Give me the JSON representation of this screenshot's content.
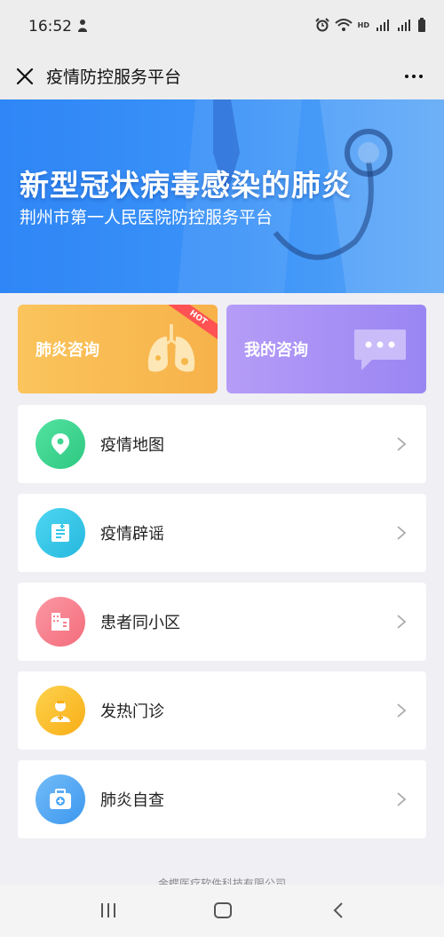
{
  "status_bar": {
    "time": "16:52",
    "left_icon": "notification-icon",
    "right_icons": [
      "alarm-icon",
      "wifi-icon",
      "hd-icon",
      "signal-4g-icon",
      "signal-4g-icon",
      "battery-icon"
    ],
    "hd_label": "HD",
    "network_label": "4G"
  },
  "title_bar": {
    "title": "疫情防控服务平台",
    "close_icon": "close-icon",
    "more_icon": "more-icon"
  },
  "banner": {
    "title": "新型冠状病毒感染的肺炎",
    "subtitle": "荆州市第一人民医院防控服务平台",
    "colors": {
      "start": "#2f86f6",
      "end": "#5aa6f6"
    }
  },
  "cards": [
    {
      "label": "肺炎咨询",
      "badge": "HOT",
      "icon": "lungs-icon",
      "color": "#f7b24a"
    },
    {
      "label": "我的咨询",
      "icon": "chat-bubble-icon",
      "color": "#9a86f3"
    }
  ],
  "menu": [
    {
      "label": "疫情地图",
      "icon": "location-pin-icon",
      "color": "#3ed68f"
    },
    {
      "label": "疫情辟谣",
      "icon": "document-icon",
      "color": "#34c6e8"
    },
    {
      "label": "患者同小区",
      "icon": "building-icon",
      "color": "#f97e8b"
    },
    {
      "label": "发热门诊",
      "icon": "doctor-icon",
      "color": "#fbbf2c"
    },
    {
      "label": "肺炎自查",
      "icon": "medical-kit-icon",
      "color": "#4aa6f4"
    }
  ],
  "footer": {
    "company": "金蝶医疗软件科技有限公司"
  },
  "nav_bar": {
    "buttons": [
      "recent-apps-icon",
      "home-icon",
      "back-icon"
    ]
  }
}
